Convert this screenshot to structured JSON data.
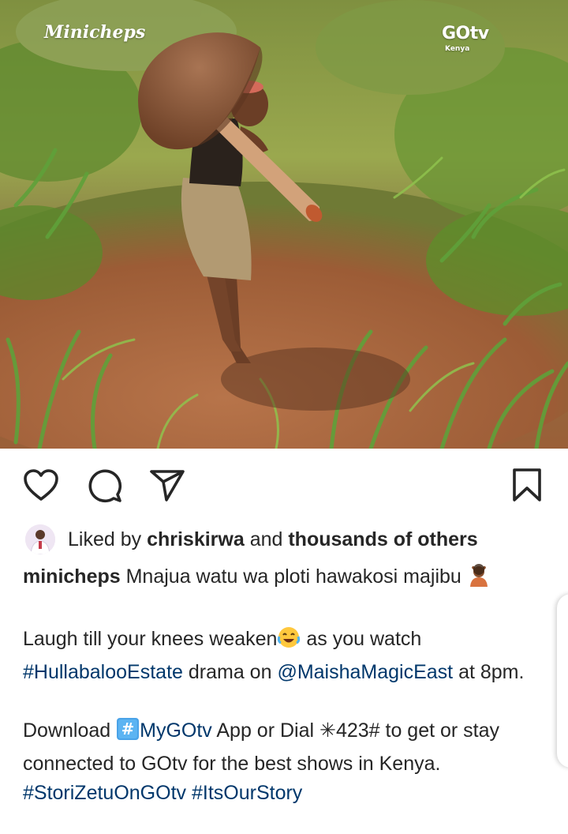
{
  "photo": {
    "brand_left": "Minicheps",
    "brand_right": "GOtv",
    "brand_right_sub": "Kenya",
    "colors": {
      "soil": "#a5683f",
      "grass": "#6f9a3a",
      "mushroom_cap": "#8a5a3a"
    }
  },
  "actions": {
    "icons": [
      "heart-icon",
      "comment-icon",
      "share-icon",
      "bookmark-icon"
    ]
  },
  "likes": {
    "prefix": "Liked by ",
    "user": "chriskirwa",
    "middle": " and ",
    "others": "thousands of others"
  },
  "caption": {
    "username": "minicheps",
    "line1": " Mnajua watu wa ploti hawakosi majibu ",
    "p2_a": "Laugh till your knees weaken",
    "p2_b": " as you watch",
    "hashtag_show": "#HullabalooEstate",
    "p2_c": " drama on ",
    "mention_channel": "@MaishaMagicEast",
    "p2_d": " at 8pm.",
    "p3_a": "Download ",
    "hash_app": "MyGOtv",
    "p3_b": " App or Dial ✳423# to get or stay connected to GOtv for the best shows in Kenya.",
    "hashtag_1": "#StoriZetuOnGOtv",
    "hashtag_2": "#ItsOurStory"
  },
  "colors": {
    "link": "#00376b",
    "text": "#262626"
  }
}
